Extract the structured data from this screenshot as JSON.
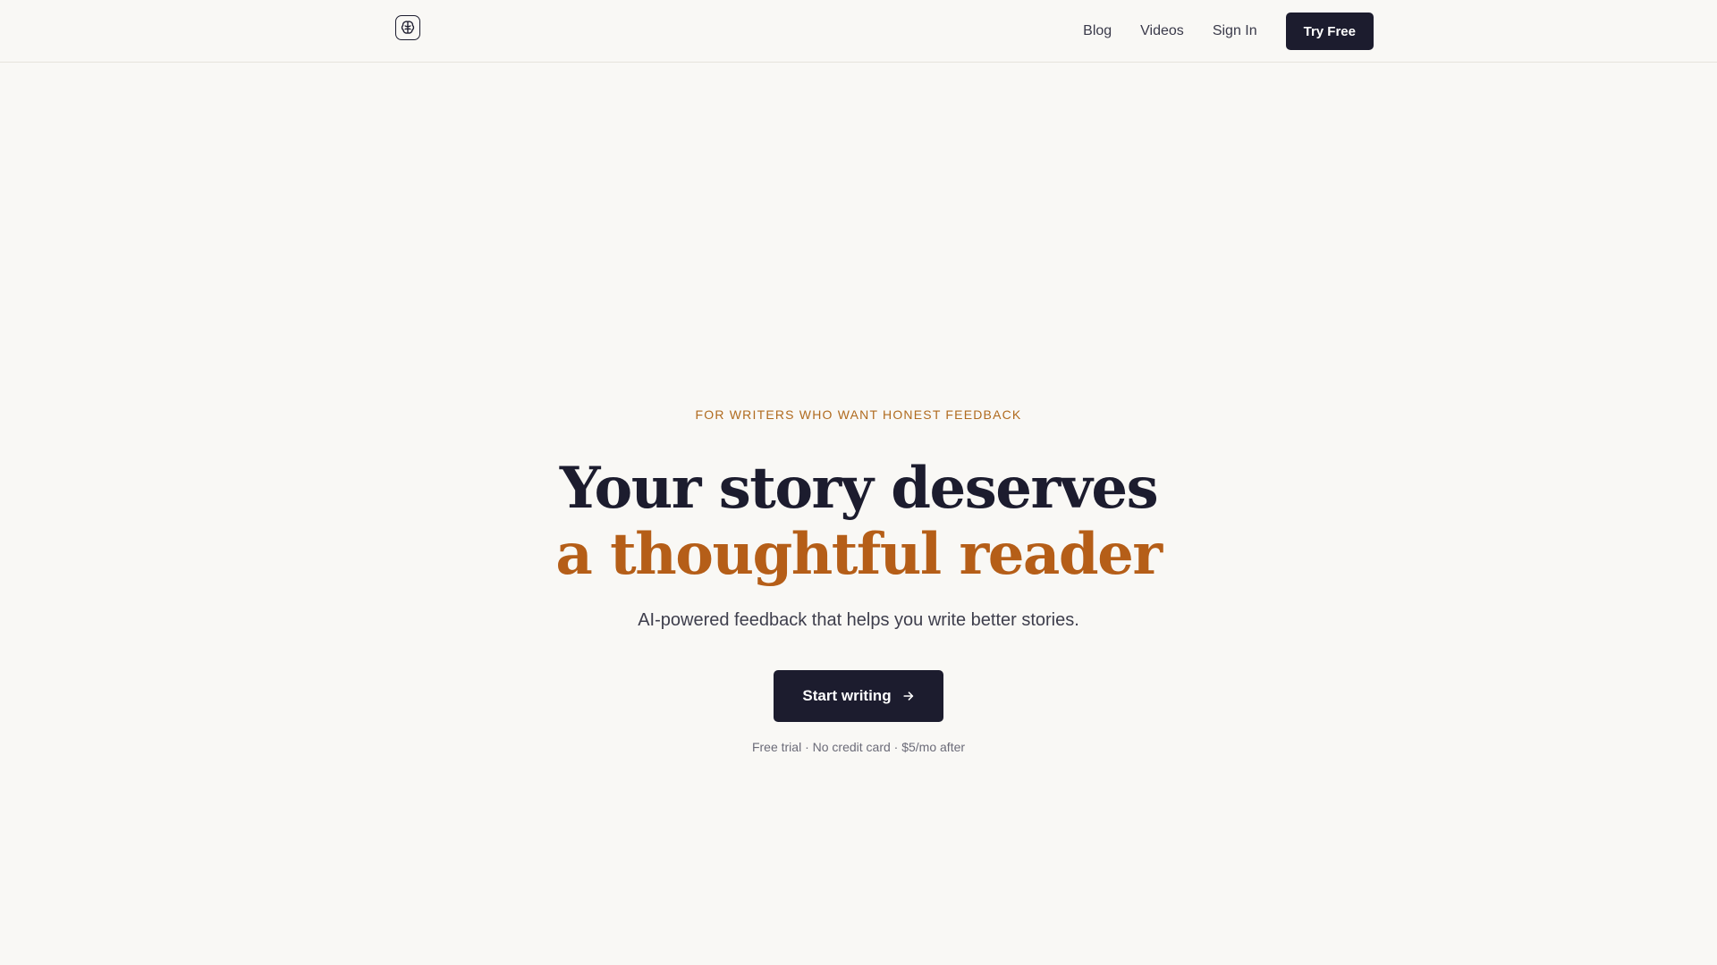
{
  "header": {
    "logo_icon": "brain-icon",
    "nav": {
      "blog": "Blog",
      "videos": "Videos",
      "sign_in": "Sign In"
    },
    "try_free": "Try Free"
  },
  "hero": {
    "eyebrow": "FOR WRITERS WHO WANT HONEST FEEDBACK",
    "headline_line1": "Your story deserves",
    "headline_line2": "a thoughtful reader",
    "subheadline": "AI-powered feedback that helps you write better stories.",
    "cta_label": "Start writing",
    "cta_icon": "arrow-right-icon",
    "fineprint": "Free trial · No credit card · $5/mo after"
  },
  "colors": {
    "background": "#f9f8f5",
    "ink": "#1c1c2e",
    "accent": "#b55e18",
    "eyebrow": "#b06a1e"
  }
}
